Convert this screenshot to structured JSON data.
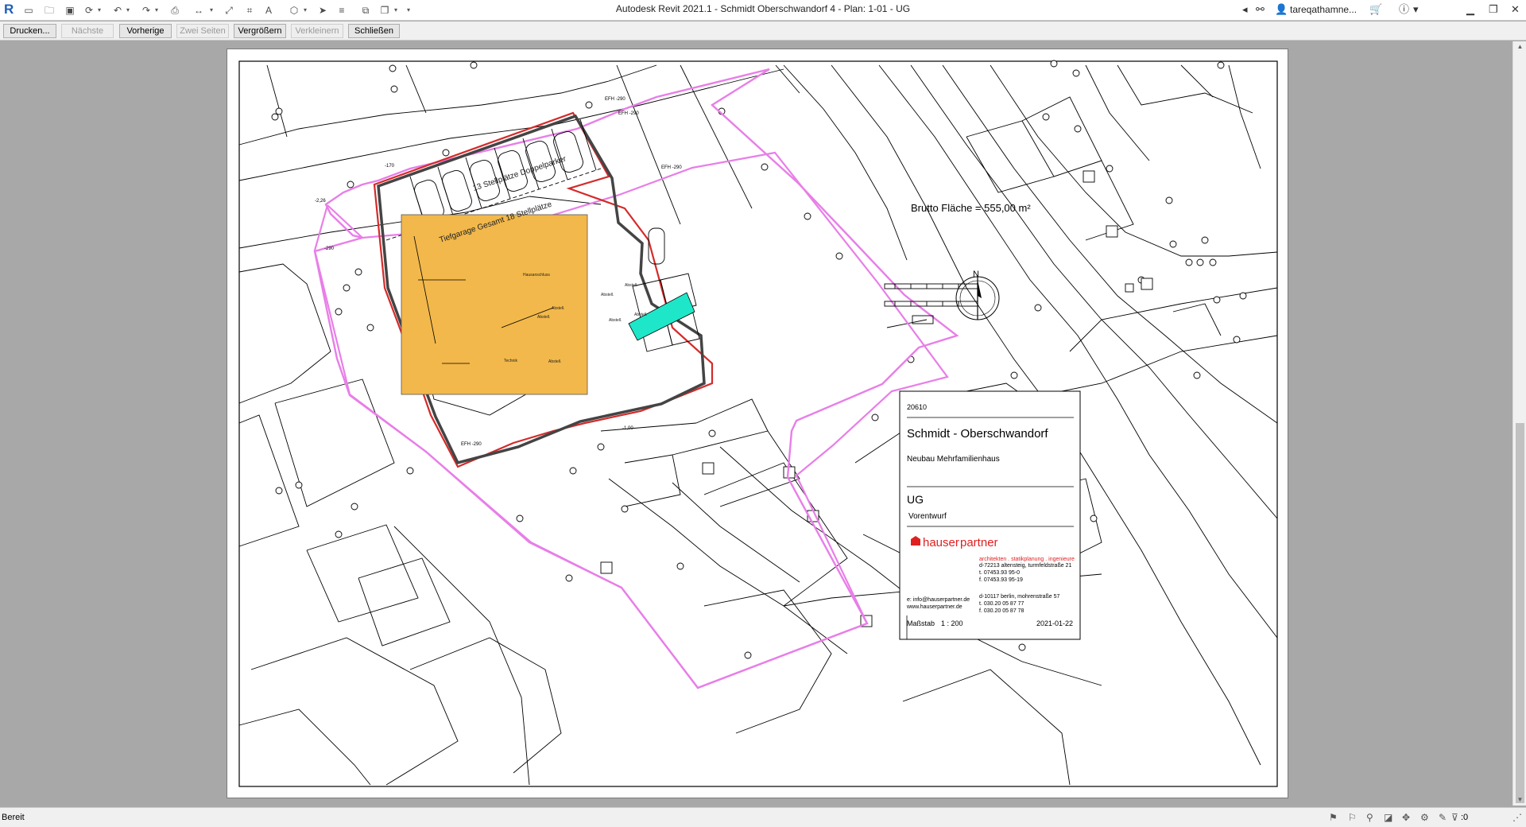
{
  "app": {
    "title": "Autodesk Revit 2021.1 - Schmidt Oberschwandorf 4 - Plan: 1-01 - UG",
    "logo_letter": "R",
    "user": "tareqathamne..."
  },
  "toolbar": {
    "buttons": [
      {
        "label": "Drucken...",
        "enabled": true
      },
      {
        "label": "Nächste",
        "enabled": false
      },
      {
        "label": "Vorherige",
        "enabled": true
      },
      {
        "label": "Zwei Seiten",
        "enabled": false
      },
      {
        "label": "Vergrößern",
        "enabled": true
      },
      {
        "label": "Verkleinern",
        "enabled": false
      },
      {
        "label": "Schließen",
        "enabled": true
      }
    ]
  },
  "drawing": {
    "area_label": "Brutto Fläche = 555,00 m²",
    "label_doppelparker": "13 Stellplätze Doppelparker",
    "label_tiefgarage": "Tiefgarage Gesamt 18 Stellplätze",
    "north": "N",
    "levels": {
      "efh1": "EFH -290",
      "efh2": "EFH -290",
      "efh3": "EFH -290",
      "efh4": "EFH -290",
      "l170": "-170",
      "l226": "-2,26",
      "l290": "-290",
      "l100": "-1,00"
    },
    "rooms": {
      "r1": "Hausanschluss",
      "r2": "Abstell.",
      "r3": "Abstell.",
      "r4": "Abstell.",
      "r5": "Technik"
    }
  },
  "title_block": {
    "project_number": "20610",
    "project_name": "Schmidt - Oberschwandorf",
    "project_desc": "Neubau Mehrfamilienhaus",
    "sheet_name": "UG",
    "status": "Vorentwurf",
    "brand_prefix": "hauser",
    "brand_suffix": "partner",
    "tagline": "architekten . statikplanung . ingenieure",
    "office1_addr": "d-72213 altensteig, turmfeldstraße 21",
    "office1_tel": "t. 07453.93 95-0",
    "office1_fax": "f. 07453.93 95-19",
    "office2_addr": "d-10117 berlin, mohrenstraße 57",
    "office2_tel": "t. 030.20 05 87 77",
    "office2_fax": "f. 030.20 05 87 78",
    "email": "e: info@hauserpartner.de",
    "web": "www.hauserpartner.de",
    "scale_label": "Maßstab",
    "scale_value": "1 : 200",
    "date": "2021-01-22"
  },
  "status": {
    "text": "Bereit",
    "filter_count": ":0"
  },
  "colors": {
    "property_line": "#e87ee8",
    "walls": "#d42a2a",
    "highlight": "#f2b84b",
    "accent": "#1ee6c8",
    "brand_red": "#e02020"
  }
}
